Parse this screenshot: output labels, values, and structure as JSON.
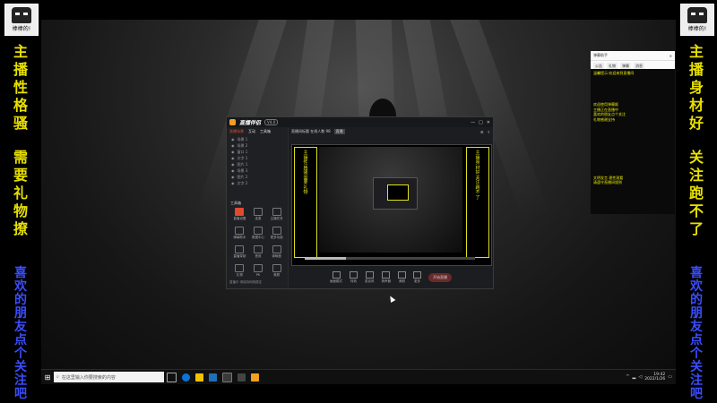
{
  "left_banner": {
    "avatar_caption": "棒棒的!",
    "yellow_text": [
      "主",
      "播",
      "性",
      "格",
      "骚",
      "",
      "需",
      "要",
      "礼",
      "物",
      "撩"
    ],
    "blue_text": [
      "喜",
      "欢",
      "的",
      "朋",
      "友",
      "点",
      "个",
      "关",
      "注",
      "吧"
    ]
  },
  "right_banner": {
    "avatar_caption": "棒棒的!",
    "yellow_text": [
      "主",
      "播",
      "身",
      "材",
      "好",
      "",
      "关",
      "注",
      "跑",
      "不",
      "了"
    ],
    "blue_text": [
      "喜",
      "欢",
      "的",
      "朋",
      "友",
      "点",
      "个",
      "关",
      "注",
      "吧"
    ]
  },
  "chat_panel": {
    "title": "弹幕助手",
    "tabs": [
      "公告",
      "礼物",
      "弹幕"
    ],
    "sub_tab": "消息",
    "messages": [
      "温馨提示:欢迎来到直播间",
      "欢迎使用弹幕姬\n主播正在直播中\n喜欢的朋友点个关注\n礼物感谢支持",
      "文明发言 理性观看\n请遵守直播间规则"
    ]
  },
  "app_window": {
    "logo": "直播伴侣",
    "version": "V4.0",
    "top_controls": [
      "—",
      "□",
      "✕"
    ],
    "left_tabs": [
      "直播场景",
      "互动",
      "工具箱"
    ],
    "scenes": [
      "场景 1",
      "场景 2",
      "窗口 1",
      "文字 1",
      "图片 1",
      "场景 3",
      "图片 2",
      "文字 2"
    ],
    "tools_label": "工具箱",
    "tools": [
      {
        "label": "直播设置",
        "red": true
      },
      {
        "label": "连麦",
        "red": false
      },
      {
        "label": "主播任务",
        "red": false
      },
      {
        "label": "弹幕助手",
        "red": false
      },
      {
        "label": "数据中心",
        "red": false
      },
      {
        "label": "更多功能",
        "red": false
      },
      {
        "label": "直播录制",
        "red": false
      },
      {
        "label": "音效",
        "red": false
      },
      {
        "label": "清晰度",
        "red": false
      },
      {
        "label": "礼物",
        "red": false
      },
      {
        "label": "PK",
        "red": false
      },
      {
        "label": "美颜",
        "red": false
      }
    ],
    "footer_hint": "直播中 请保持网络稳定",
    "main_title": "直播间标题 在线人数 98",
    "main_badge": "直播",
    "preview_left_text": [
      "主",
      "播",
      "性",
      "格",
      "骚",
      "需",
      "要",
      "礼",
      "物"
    ],
    "preview_right_text": [
      "主",
      "播",
      "身",
      "材",
      "好",
      "关",
      "注",
      "跑",
      "不",
      "了"
    ],
    "progress_fraction": 0.24,
    "bottom_tools": [
      "画面模式",
      "特效",
      "麦克风",
      "扬声器",
      "美颜",
      "更多"
    ],
    "live_button": "开始直播"
  },
  "taskbar": {
    "search_placeholder": "在这里输入你要搜索的内容",
    "time": "19:42",
    "date": "2022/1/26",
    "start_icon": "windows-icon"
  }
}
